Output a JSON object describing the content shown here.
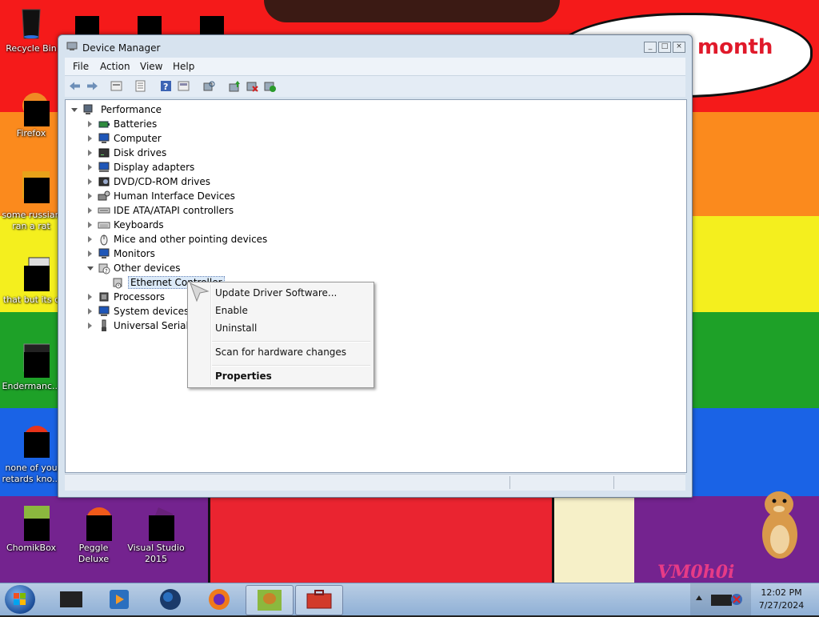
{
  "desktop": {
    "wallpaper_text": "month",
    "wallpaper_signature": "VM0h0i",
    "icons": [
      {
        "label": "Recycle Bin"
      },
      {
        "label": "Firefox"
      },
      {
        "label": "some russian ran a rat"
      },
      {
        "label": "that but its c"
      },
      {
        "label": "Endermanc..."
      },
      {
        "label": "none of you retards kno..."
      },
      {
        "label": "ChomikBox"
      },
      {
        "label": "Peggle Deluxe"
      },
      {
        "label": "Visual Studio 2015"
      }
    ]
  },
  "window": {
    "title": "Device Manager",
    "controls": {
      "minimize": "_",
      "maximize": "□",
      "close": "×"
    },
    "menu": [
      "File",
      "Action",
      "View",
      "Help"
    ],
    "tree": {
      "root": "Performance",
      "items": [
        {
          "label": "Batteries"
        },
        {
          "label": "Computer"
        },
        {
          "label": "Disk drives"
        },
        {
          "label": "Display adapters"
        },
        {
          "label": "DVD/CD-ROM drives"
        },
        {
          "label": "Human Interface Devices"
        },
        {
          "label": "IDE ATA/ATAPI controllers"
        },
        {
          "label": "Keyboards"
        },
        {
          "label": "Mice and other pointing devices"
        },
        {
          "label": "Monitors"
        },
        {
          "label": "Other devices"
        },
        {
          "label": "Ethernet Controller"
        },
        {
          "label": "Processors"
        },
        {
          "label": "System devices"
        },
        {
          "label": "Universal Serial B"
        }
      ]
    }
  },
  "context_menu": {
    "items": [
      {
        "label": "Update Driver Software..."
      },
      {
        "label": "Enable"
      },
      {
        "label": "Uninstall"
      },
      {
        "label": "Scan for hardware changes"
      },
      {
        "label": "Properties"
      }
    ]
  },
  "taskbar": {
    "time": "12:02 PM",
    "date": "7/27/2024"
  }
}
